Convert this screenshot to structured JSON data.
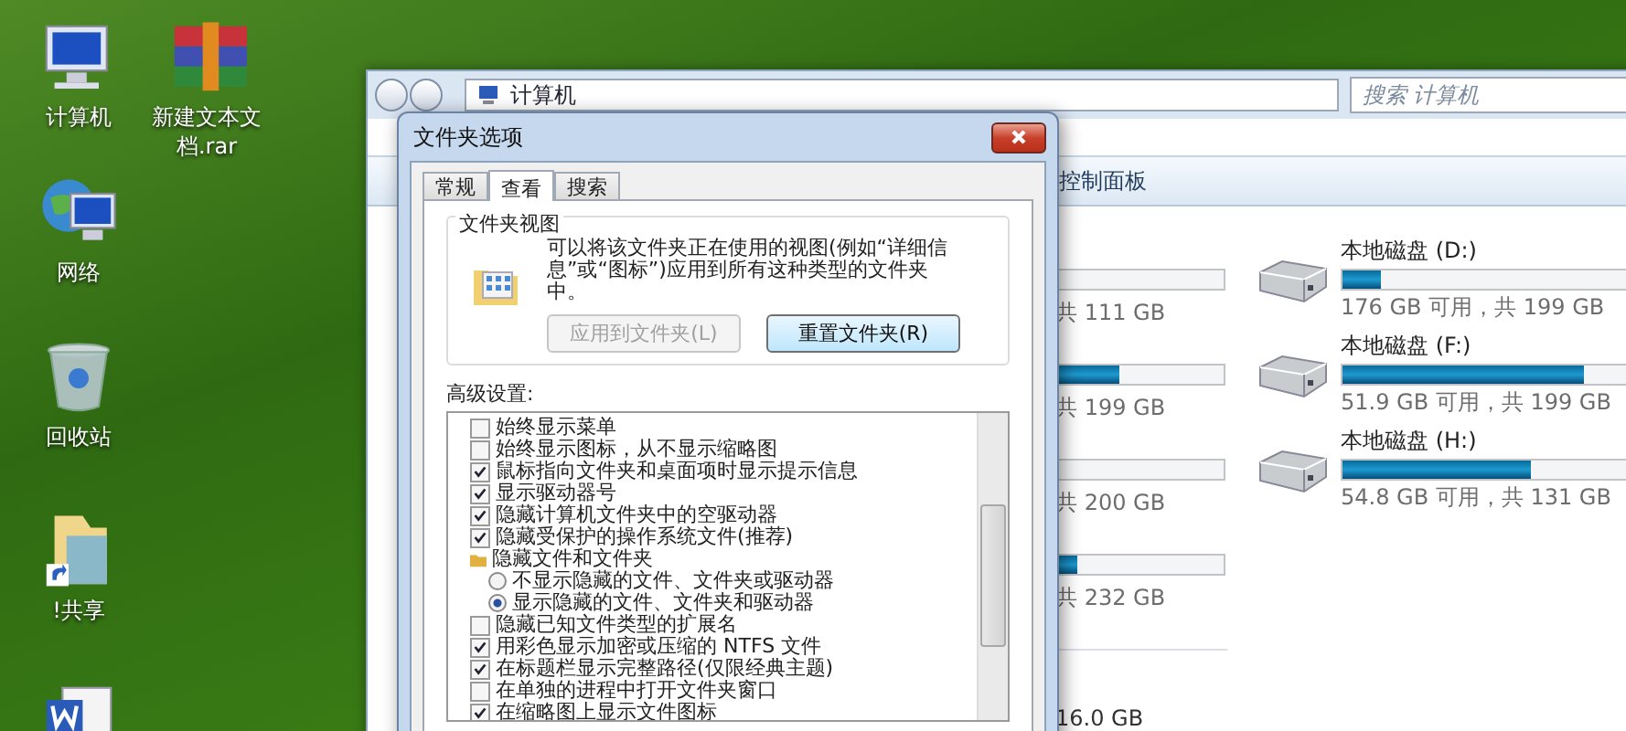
{
  "desktop_icons": [
    {
      "kind": "computer",
      "label": "计算机"
    },
    {
      "kind": "archive",
      "label": "新建文本文档.rar"
    },
    {
      "kind": "network",
      "label": "网络"
    },
    {
      "kind": "recycle",
      "label": "回收站"
    },
    {
      "kind": "shortcut",
      "label": "!共享"
    },
    {
      "kind": "word"
    }
  ],
  "explorer": {
    "address": "计算机",
    "search": {
      "placeholder": "搜索 计算机"
    },
    "toolbar_item": "控制面板",
    "partial_drives": [
      {
        "level": 0,
        "size_text": "共 111 GB"
      },
      {
        "level": 0.37,
        "size_text": "共 199 GB"
      },
      {
        "level": 0,
        "size_text": "共 200 GB"
      },
      {
        "level": 0.12,
        "size_text": "共 232 GB"
      }
    ],
    "drives": [
      {
        "name": "本地磁盘 (D:)",
        "level": 0.12,
        "size_text": "176 GB 可用，共 199 GB"
      },
      {
        "name": "本地磁盘 (F:)",
        "level": 0.74,
        "size_text": "51.9 GB 可用，共 199 GB"
      },
      {
        "name": "本地磁盘 (H:)",
        "level": 0.58,
        "size_text": "54.8 GB 可用，共 131 GB"
      }
    ],
    "bottom_text": "16.0 GB"
  },
  "dialog": {
    "title": "文件夹选项",
    "tabs": [
      {
        "label": "常规",
        "selected": false
      },
      {
        "label": "查看",
        "selected": true
      },
      {
        "label": "搜索",
        "selected": false
      }
    ],
    "folder_views": {
      "title": "文件夹视图",
      "description": "可以将该文件夹正在使用的视图(例如“详细信息”或“图标”)应用到所有这种类型的文件夹中。",
      "buttons": [
        {
          "label": "应用到文件夹(L)",
          "disabled": true
        },
        {
          "label": "重置文件夹(R)",
          "disabled": false
        }
      ]
    },
    "advanced_label": "高级设置:",
    "settings": [
      {
        "kind": "checkbox",
        "label": "始终显示菜单",
        "checked": false
      },
      {
        "kind": "checkbox",
        "label": "始终显示图标，从不显示缩略图",
        "checked": false
      },
      {
        "kind": "checkbox",
        "label": "鼠标指向文件夹和桌面项时显示提示信息",
        "checked": true
      },
      {
        "kind": "checkbox",
        "label": "显示驱动器号",
        "checked": true
      },
      {
        "kind": "checkbox",
        "label": "隐藏计算机文件夹中的空驱动器",
        "checked": true
      },
      {
        "kind": "checkbox",
        "label": "隐藏受保护的操作系统文件(推荐)",
        "checked": true
      },
      {
        "kind": "folder",
        "label": "隐藏文件和文件夹"
      },
      {
        "kind": "radio",
        "label": "不显示隐藏的文件、文件夹或驱动器",
        "selected": false
      },
      {
        "kind": "radio",
        "label": "显示隐藏的文件、文件夹和驱动器",
        "selected": true
      },
      {
        "kind": "checkbox",
        "label": "隐藏已知文件类型的扩展名",
        "checked": false
      },
      {
        "kind": "checkbox",
        "label": "用彩色显示加密或压缩的 NTFS 文件",
        "checked": true
      },
      {
        "kind": "checkbox",
        "label": "在标题栏显示完整路径(仅限经典主题)",
        "checked": true
      },
      {
        "kind": "checkbox",
        "label": "在单独的进程中打开文件夹窗口",
        "checked": false
      },
      {
        "kind": "checkbox",
        "label": "在缩略图上显示文件图标",
        "checked": true
      }
    ]
  }
}
